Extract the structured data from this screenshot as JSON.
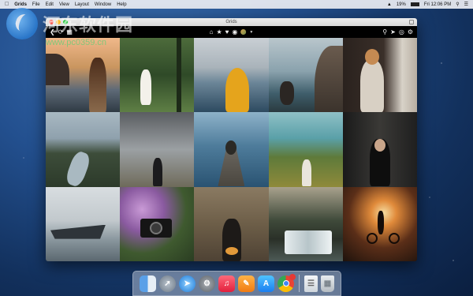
{
  "menubar": {
    "apple": "",
    "app_name": "Grids",
    "items": [
      "File",
      "Edit",
      "View",
      "Layout",
      "Window",
      "Help"
    ],
    "battery": "19%",
    "clock": "Fri 12:06 PM"
  },
  "window": {
    "title": "Grids"
  },
  "watermark": {
    "text": "河东软件园",
    "url": "www.pc0359.cn"
  },
  "toolbar": {
    "left_icons": [
      "back-icon",
      "refresh-icon",
      "grid-icon"
    ],
    "center_icons": [
      "home-icon",
      "star-icon",
      "heart-icon",
      "location-icon",
      "profile-avatar"
    ],
    "right_icons": [
      "search-icon",
      "send-icon",
      "notifications-icon",
      "settings-icon"
    ]
  },
  "photos": [
    {
      "name": "girl-at-sea-sunset"
    },
    {
      "name": "girl-white-dress-field"
    },
    {
      "name": "yellow-raincoat-lake"
    },
    {
      "name": "couple-on-cliff"
    },
    {
      "name": "man-at-window"
    },
    {
      "name": "river-valley"
    },
    {
      "name": "woman-in-fog"
    },
    {
      "name": "pier-sitting"
    },
    {
      "name": "woman-in-meadow"
    },
    {
      "name": "woman-in-dark-room"
    },
    {
      "name": "boat-on-lake"
    },
    {
      "name": "camera-in-flowers"
    },
    {
      "name": "man-in-tall-grass"
    },
    {
      "name": "waterfall-forest"
    },
    {
      "name": "bike-at-sunset"
    }
  ],
  "dock": {
    "apps": [
      "Finder",
      "Launchpad",
      "Safari",
      "System Preferences",
      "Music",
      "Books",
      "App Store",
      "Chrome"
    ],
    "chrome_badge": "",
    "trailing": [
      "Document",
      "Trash"
    ]
  }
}
